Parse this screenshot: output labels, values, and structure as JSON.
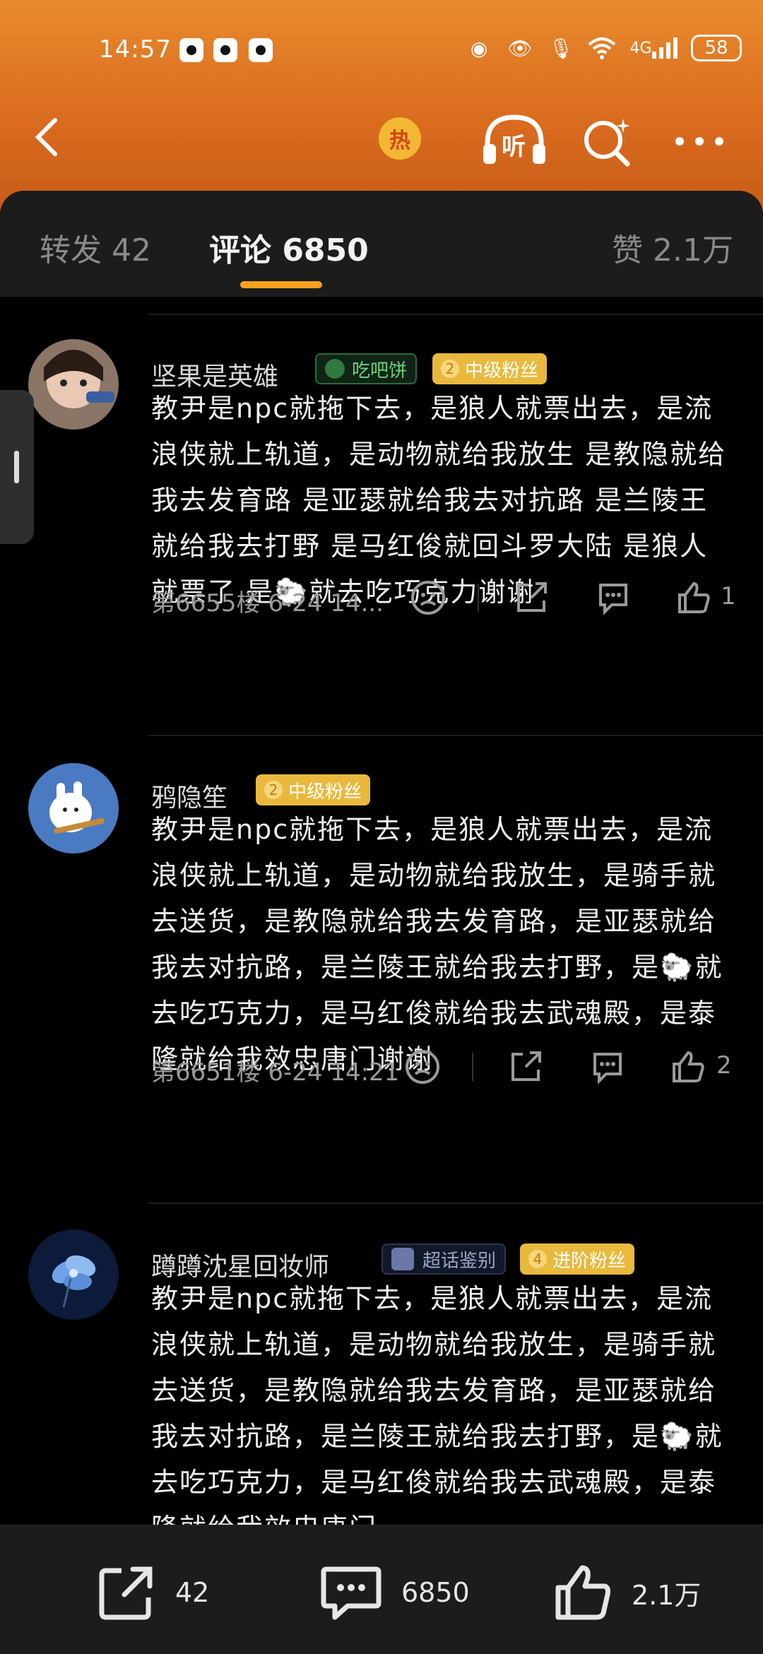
{
  "status_bar": {
    "time": "14:57",
    "battery": "58",
    "network": "4G"
  },
  "nav": {
    "hot_label": "热",
    "listen_label": "听"
  },
  "tabs": [
    {
      "label": "转发 42"
    },
    {
      "label": "评论 6850"
    },
    {
      "label": "赞 2.1万"
    }
  ],
  "comments": [
    {
      "username": "坚果是英雄",
      "badges": [
        {
          "type": "green",
          "text": "吃吧饼"
        },
        {
          "type": "gold",
          "level": "2",
          "text": "中级粉丝"
        }
      ],
      "text": "教尹是npc就拖下去，是狼人就票出去，是流浪侠就上轨道，是动物就给我放生 是教隐就给我去发育路 是亚瑟就给我去对抗路 是兰陵王就给我去打野 是马红俊就回斗罗大陆 是狼人就票了 是🐑就去吃巧克力谢谢",
      "meta": "第6655楼 6-24 14...",
      "likes": "1"
    },
    {
      "username": "鸦隐笙",
      "badges": [
        {
          "type": "gold",
          "level": "2",
          "text": "中级粉丝"
        }
      ],
      "text": "教尹是npc就拖下去，是狼人就票出去，是流浪侠就上轨道，是动物就给我放生，是骑手就去送货，是教隐就给我去发育路，是亚瑟就给我去对抗路，是兰陵王就给我去打野，是🐑就去吃巧克力，是马红俊就给我去武魂殿，是泰隆就给我效忠唐门谢谢",
      "meta": "第6651楼 6-24 14:21",
      "likes": "2"
    },
    {
      "username": "蹲蹲沈星回妆师",
      "badges": [
        {
          "type": "blue",
          "text": "超话鉴别"
        },
        {
          "type": "gold",
          "level": "4",
          "text": "进阶粉丝"
        }
      ],
      "text": "教尹是npc就拖下去，是狼人就票出去，是流浪侠就上轨道，是动物就给我放生，是骑手就去送货，是教隐就给我去发育路，是亚瑟就给我去对抗路，是兰陵王就给我去打野，是🐑就去吃巧克力，是马红俊就给我去武魂殿，是泰隆就给我效忠唐门",
      "meta": "",
      "likes": ""
    }
  ],
  "bottom_bar": {
    "share_count": "42",
    "comment_count": "6850",
    "like_count": "2.1万"
  }
}
